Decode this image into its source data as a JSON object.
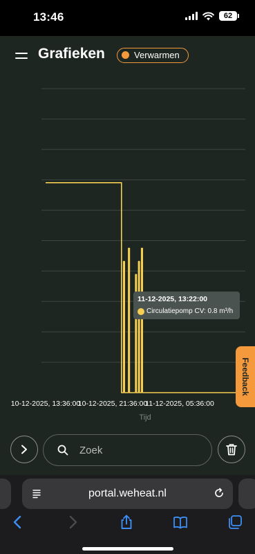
{
  "status_bar": {
    "time": "13:46",
    "battery": "62"
  },
  "header": {
    "title": "Grafieken",
    "mode_badge": "Verwarmen"
  },
  "chart_data": {
    "type": "line",
    "title": "",
    "xlabel": "Tijd",
    "ylabel": "",
    "x_tick_labels": [
      "10-12-2025, 13:36:00",
      "10-12-2025, 21:36:00",
      "11-12-2025, 05:36:00"
    ],
    "ylim": [
      0,
      1
    ],
    "y_grid_count": 10,
    "grid": true,
    "series": [
      {
        "name": "Circulatiepomp CV",
        "unit": "m³/h",
        "color": "#f6ce52",
        "x": [
          0.0,
          0.17,
          0.18,
          0.37,
          0.38,
          0.385,
          0.39,
          0.395,
          0.4,
          0.405,
          0.41,
          0.415,
          0.42,
          0.425,
          0.43,
          0.44,
          0.445,
          0.45,
          0.455,
          0.46,
          0.465,
          0.47,
          0.475,
          0.48,
          0.485,
          0.49,
          0.5,
          0.52,
          0.56,
          0.6,
          0.64,
          0.68,
          0.7,
          0.72,
          0.74,
          0.76,
          0.78,
          0.8,
          0.82,
          0.84,
          0.86,
          0.88,
          0.9,
          0.92,
          0.94,
          0.96,
          0.98,
          1.0
        ],
        "values": [
          0.8,
          0.8,
          0.8,
          0.8,
          0.0,
          0.0,
          0.5,
          0.0,
          0.0,
          0.0,
          0.0,
          0.55,
          0.0,
          0.0,
          0.0,
          0.0,
          0.0,
          0.45,
          0.0,
          0.0,
          0.5,
          0.0,
          0.0,
          0.55,
          0.0,
          0.0,
          0.0,
          0.0,
          0.0,
          0.0,
          0.0,
          0.0,
          0.0,
          0.0,
          0.0,
          0.0,
          0.0,
          0.0,
          0.0,
          0.0,
          0.0,
          0.0,
          0.0,
          0.0,
          0.0,
          0.0,
          0.0,
          0.0
        ]
      }
    ],
    "tooltip": {
      "title": "11-12-2025, 13:22:00",
      "label": "Circulatiepomp CV: 0.8 m³/h"
    }
  },
  "feedback": {
    "label": "Feedback"
  },
  "search": {
    "placeholder": "Zoek"
  },
  "safari": {
    "url": "portal.weheat.nl"
  },
  "colors": {
    "background": "#1e2622",
    "accent": "#f59a3c",
    "series": "#f6ce52"
  }
}
